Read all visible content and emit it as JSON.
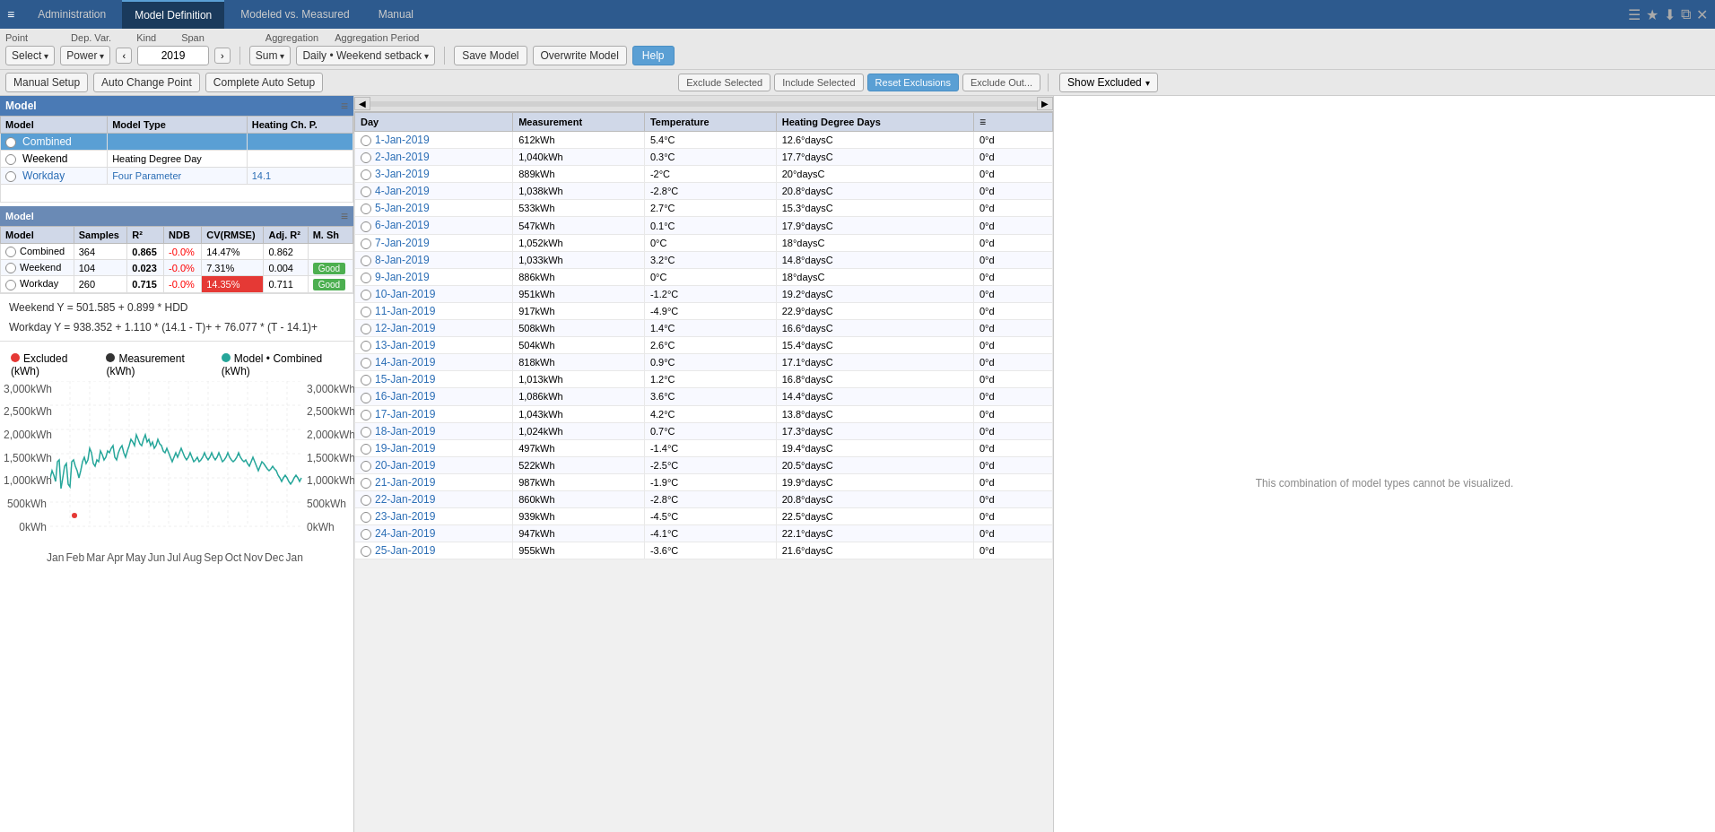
{
  "app": {
    "logo": "≡",
    "nav_tabs": [
      "Administration",
      "Model Definition",
      "Modeled vs. Measured",
      "Manual"
    ],
    "active_tab": "Model Definition",
    "top_right_icons": [
      "☰",
      "★",
      "⬇",
      "⧉",
      "✕"
    ]
  },
  "toolbar": {
    "labels": [
      "Point",
      "Dep. Var.",
      "Kind",
      "Span",
      "",
      "Aggregation",
      "Aggregation Period"
    ],
    "select_label": "Select",
    "power_label": "Power",
    "year": "2019",
    "sum_label": "Sum",
    "period_label": "Daily • Weekend setback",
    "save_model": "Save Model",
    "overwrite_model": "Overwrite Model",
    "help": "Help"
  },
  "toolbar2": {
    "manual_setup": "Manual Setup",
    "auto_change_point": "Auto Change Point",
    "complete_auto_setup": "Complete Auto Setup"
  },
  "model_table": {
    "title": "Model",
    "columns": [
      "Model",
      "Model Type",
      "Heating Ch. P."
    ],
    "rows": [
      {
        "model": "Combined",
        "model_type": "",
        "heating": "",
        "selected": true
      },
      {
        "model": "Weekend",
        "model_type": "Heating Degree Day",
        "heating": "",
        "selected": false
      },
      {
        "model": "Workday",
        "model_type": "Four Parameter",
        "heating": "14.1",
        "selected": false
      }
    ]
  },
  "stats_table": {
    "columns": [
      "Model",
      "Samples",
      "R²",
      "NDB",
      "CV(RMSE)",
      "Adj. R²",
      "M. Sh"
    ],
    "rows": [
      {
        "model": "Combined",
        "samples": "364",
        "r2": "0.865",
        "ndb": "-0.0%",
        "cv": "14.47%",
        "adj_r2": "0.862",
        "msh": "",
        "ndb_color": "red",
        "cv_color": "none"
      },
      {
        "model": "Weekend",
        "samples": "104",
        "r2": "0.023",
        "ndb": "-0.0%",
        "cv": "7.31%",
        "adj_r2": "0.004",
        "msh": "Good",
        "ndb_color": "red",
        "cv_color": "none",
        "msh_color": "green"
      },
      {
        "model": "Workday",
        "samples": "260",
        "r2": "0.715",
        "ndb": "-0.0%",
        "cv": "14.35%",
        "adj_r2": "0.711",
        "msh": "Good",
        "ndb_color": "red",
        "cv_color": "red",
        "msh_color": "green"
      }
    ]
  },
  "formulas": {
    "line1": "Weekend Y = 501.585 + 0.899 * HDD",
    "line2": "Workday Y = 938.352 + 1.110 * (14.1 - T)+ + 76.077 * (T - 14.1)+"
  },
  "chart": {
    "legend": [
      {
        "label": "Excluded (kWh)",
        "color": "#e53935"
      },
      {
        "label": "Measurement (kWh)",
        "color": "#333"
      },
      {
        "label": "Model • Combined (kWh)",
        "color": "#26a69a"
      }
    ],
    "y_labels": [
      "3,000kWh",
      "2,500kWh",
      "2,000kWh",
      "1,500kWh",
      "1,000kWh",
      "500kWh",
      "0kWh"
    ],
    "x_labels": [
      "Jan",
      "Feb",
      "Mar",
      "Apr",
      "May",
      "Jun",
      "Jul",
      "Aug",
      "Sep",
      "Oct",
      "Nov",
      "Dec",
      "Jan"
    ],
    "y_right": [
      "3,000kWh",
      "2,500kWh",
      "2,000kWh",
      "1,500kWh",
      "1,000kWh",
      "500kWh",
      "0kWh"
    ]
  },
  "day_table": {
    "toolbar": {
      "exclude_selected": "Exclude Selected",
      "include_selected": "Include Selected",
      "reset_exclusions": "Reset Exclusions",
      "exclude_out": "Exclude Out...",
      "show_excluded": "Show Excluded"
    },
    "columns": [
      "Day",
      "Measurement",
      "Temperature",
      "Heating Degree Days"
    ],
    "rows": [
      {
        "day": "1-Jan-2019",
        "measurement": "612kWh",
        "temperature": "5.4°C",
        "hdd": "12.6°daysC",
        "extra": "0°d"
      },
      {
        "day": "2-Jan-2019",
        "measurement": "1,040kWh",
        "temperature": "0.3°C",
        "hdd": "17.7°daysC",
        "extra": "0°d"
      },
      {
        "day": "3-Jan-2019",
        "measurement": "889kWh",
        "temperature": "-2°C",
        "hdd": "20°daysC",
        "extra": "0°d"
      },
      {
        "day": "4-Jan-2019",
        "measurement": "1,038kWh",
        "temperature": "-2.8°C",
        "hdd": "20.8°daysC",
        "extra": "0°d"
      },
      {
        "day": "5-Jan-2019",
        "measurement": "533kWh",
        "temperature": "2.7°C",
        "hdd": "15.3°daysC",
        "extra": "0°d"
      },
      {
        "day": "6-Jan-2019",
        "measurement": "547kWh",
        "temperature": "0.1°C",
        "hdd": "17.9°daysC",
        "extra": "0°d"
      },
      {
        "day": "7-Jan-2019",
        "measurement": "1,052kWh",
        "temperature": "0°C",
        "hdd": "18°daysC",
        "extra": "0°d"
      },
      {
        "day": "8-Jan-2019",
        "measurement": "1,033kWh",
        "temperature": "3.2°C",
        "hdd": "14.8°daysC",
        "extra": "0°d"
      },
      {
        "day": "9-Jan-2019",
        "measurement": "886kWh",
        "temperature": "0°C",
        "hdd": "18°daysC",
        "extra": "0°d"
      },
      {
        "day": "10-Jan-2019",
        "measurement": "951kWh",
        "temperature": "-1.2°C",
        "hdd": "19.2°daysC",
        "extra": "0°d"
      },
      {
        "day": "11-Jan-2019",
        "measurement": "917kWh",
        "temperature": "-4.9°C",
        "hdd": "22.9°daysC",
        "extra": "0°d"
      },
      {
        "day": "12-Jan-2019",
        "measurement": "508kWh",
        "temperature": "1.4°C",
        "hdd": "16.6°daysC",
        "extra": "0°d"
      },
      {
        "day": "13-Jan-2019",
        "measurement": "504kWh",
        "temperature": "2.6°C",
        "hdd": "15.4°daysC",
        "extra": "0°d"
      },
      {
        "day": "14-Jan-2019",
        "measurement": "818kWh",
        "temperature": "0.9°C",
        "hdd": "17.1°daysC",
        "extra": "0°d"
      },
      {
        "day": "15-Jan-2019",
        "measurement": "1,013kWh",
        "temperature": "1.2°C",
        "hdd": "16.8°daysC",
        "extra": "0°d"
      },
      {
        "day": "16-Jan-2019",
        "measurement": "1,086kWh",
        "temperature": "3.6°C",
        "hdd": "14.4°daysC",
        "extra": "0°d"
      },
      {
        "day": "17-Jan-2019",
        "measurement": "1,043kWh",
        "temperature": "4.2°C",
        "hdd": "13.8°daysC",
        "extra": "0°d"
      },
      {
        "day": "18-Jan-2019",
        "measurement": "1,024kWh",
        "temperature": "0.7°C",
        "hdd": "17.3°daysC",
        "extra": "0°d"
      },
      {
        "day": "19-Jan-2019",
        "measurement": "497kWh",
        "temperature": "-1.4°C",
        "hdd": "19.4°daysC",
        "extra": "0°d"
      },
      {
        "day": "20-Jan-2019",
        "measurement": "522kWh",
        "temperature": "-2.5°C",
        "hdd": "20.5°daysC",
        "extra": "0°d"
      },
      {
        "day": "21-Jan-2019",
        "measurement": "987kWh",
        "temperature": "-1.9°C",
        "hdd": "19.9°daysC",
        "extra": "0°d"
      },
      {
        "day": "22-Jan-2019",
        "measurement": "860kWh",
        "temperature": "-2.8°C",
        "hdd": "20.8°daysC",
        "extra": "0°d"
      },
      {
        "day": "23-Jan-2019",
        "measurement": "939kWh",
        "temperature": "-4.5°C",
        "hdd": "22.5°daysC",
        "extra": "0°d"
      },
      {
        "day": "24-Jan-2019",
        "measurement": "947kWh",
        "temperature": "-4.1°C",
        "hdd": "22.1°daysC",
        "extra": "0°d"
      },
      {
        "day": "25-Jan-2019",
        "measurement": "955kWh",
        "temperature": "-3.6°C",
        "hdd": "21.6°daysC",
        "extra": "0°d"
      }
    ]
  },
  "viz_area": {
    "message": "This combination of model types cannot be visualized."
  }
}
